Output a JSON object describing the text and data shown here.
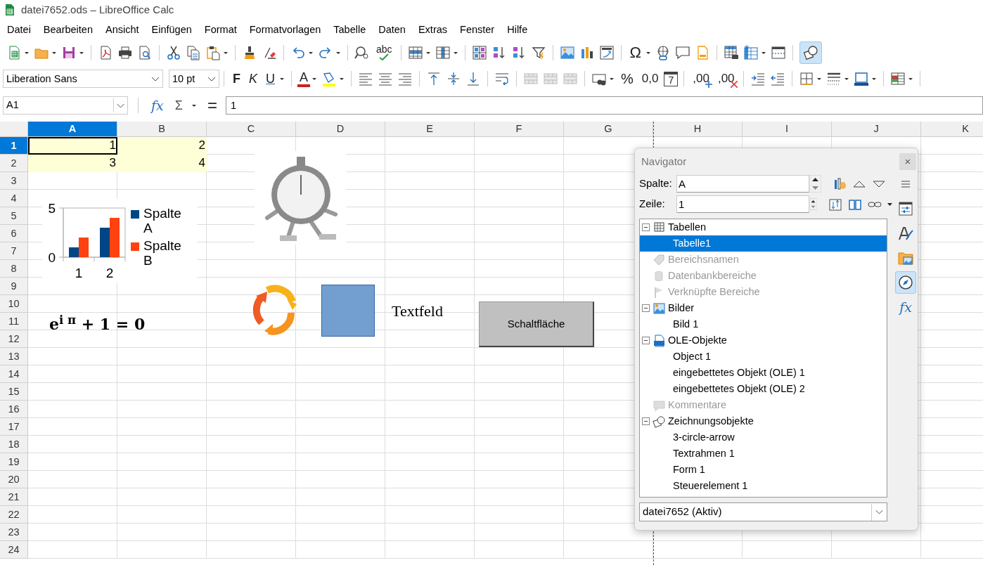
{
  "window": {
    "title": "datei7652.ods – LibreOffice Calc"
  },
  "menu": [
    {
      "label": "Datei"
    },
    {
      "label": "Bearbeiten"
    },
    {
      "label": "Ansicht"
    },
    {
      "label": "Einfügen"
    },
    {
      "label": "Format"
    },
    {
      "label": "Formatvorlagen"
    },
    {
      "label": "Tabelle"
    },
    {
      "label": "Daten"
    },
    {
      "label": "Extras"
    },
    {
      "label": "Fenster"
    },
    {
      "label": "Hilfe"
    }
  ],
  "standard_toolbar": {
    "spelling": "abc",
    "special_character": "Ω",
    "draw_functions_active": true
  },
  "formatting_toolbar": {
    "font_name": "Liberation Sans",
    "font_size": "10 pt",
    "bold": "F",
    "italic": "K",
    "underline": "U",
    "font_color": "A",
    "percent": "%",
    "number": "0,0",
    "date": "7",
    "add_decimal": ",00",
    "delete_decimal": ",00"
  },
  "formula_bar": {
    "name_box": "A1",
    "function_wizard": "fx",
    "sum": "Σ",
    "formula": "=",
    "content": "1"
  },
  "sheet": {
    "columns": [
      {
        "label": "A",
        "selected": true
      },
      {
        "label": "B",
        "selected": false
      },
      {
        "label": "C",
        "selected": false
      },
      {
        "label": "D",
        "selected": false
      },
      {
        "label": "E",
        "selected": false
      },
      {
        "label": "F",
        "selected": false
      },
      {
        "label": "G",
        "selected": false
      },
      {
        "label": "H",
        "selected": false
      },
      {
        "label": "I",
        "selected": false
      },
      {
        "label": "J",
        "selected": false
      },
      {
        "label": "K",
        "selected": false
      }
    ],
    "rows": [
      {
        "label": "1",
        "selected": true,
        "cells": [
          {
            "value": "1",
            "active": true
          },
          {
            "value": "2",
            "active": false
          }
        ]
      },
      {
        "label": "2",
        "selected": false,
        "cells": [
          {
            "value": "3",
            "active": false
          },
          {
            "value": "4",
            "active": false
          }
        ]
      },
      {
        "label": "3",
        "selected": false
      },
      {
        "label": "4",
        "selected": false
      },
      {
        "label": "5",
        "selected": false
      },
      {
        "label": "6",
        "selected": false
      },
      {
        "label": "7",
        "selected": false
      },
      {
        "label": "8",
        "selected": false
      },
      {
        "label": "9",
        "selected": false
      },
      {
        "label": "10",
        "selected": false
      },
      {
        "label": "11",
        "selected": false
      },
      {
        "label": "12",
        "selected": false
      },
      {
        "label": "13",
        "selected": false
      },
      {
        "label": "14",
        "selected": false
      },
      {
        "label": "15",
        "selected": false
      },
      {
        "label": "16",
        "selected": false
      },
      {
        "label": "17",
        "selected": false
      },
      {
        "label": "18",
        "selected": false
      },
      {
        "label": "19",
        "selected": false
      },
      {
        "label": "20",
        "selected": false
      },
      {
        "label": "21",
        "selected": false
      },
      {
        "label": "22",
        "selected": false
      },
      {
        "label": "23",
        "selected": false
      },
      {
        "label": "24",
        "selected": false
      }
    ]
  },
  "objects": {
    "chart": {
      "chart_data": {
        "type": "bar",
        "categories": [
          "1",
          "2"
        ],
        "series": [
          {
            "name": "Spalte A",
            "color": "#004586",
            "values": [
              1,
              3
            ]
          },
          {
            "name": "Spalte B",
            "color": "#ff420e",
            "values": [
              2,
              4
            ]
          }
        ],
        "ylim": [
          0,
          5
        ],
        "yticks": [
          0,
          5
        ],
        "legend": "right"
      }
    },
    "formula": "e$^{i π}$ + 1 = 0",
    "text_box": "Textfeld",
    "button": "Schaltfläche"
  },
  "navigator": {
    "title": "Navigator",
    "close": "×",
    "column_label": "Spalte:",
    "column_value": "A",
    "row_label": "Zeile:",
    "row_value": "1",
    "tree": [
      {
        "label": "Tabellen",
        "kind": "sheets",
        "expanded": true,
        "disabled": false,
        "selected": false,
        "children": [
          {
            "label": "Tabelle1",
            "selected": true,
            "disabled": false
          }
        ]
      },
      {
        "label": "Bereichsnamen",
        "kind": "names",
        "disabled": true,
        "selected": false
      },
      {
        "label": "Datenbankbereiche",
        "kind": "database",
        "disabled": true,
        "selected": false
      },
      {
        "label": "Verknüpfte Bereiche",
        "kind": "links",
        "disabled": true,
        "selected": false
      },
      {
        "label": "Bilder",
        "kind": "images",
        "expanded": true,
        "disabled": false,
        "selected": false,
        "children": [
          {
            "label": "Bild 1",
            "selected": false,
            "disabled": false
          }
        ]
      },
      {
        "label": "OLE-Objekte",
        "kind": "ole",
        "expanded": true,
        "disabled": false,
        "selected": false,
        "children": [
          {
            "label": "Object 1",
            "selected": false,
            "disabled": false
          },
          {
            "label": "eingebettetes Objekt (OLE) 1",
            "selected": false,
            "disabled": false
          },
          {
            "label": "eingebettetes Objekt (OLE) 2",
            "selected": false,
            "disabled": false
          }
        ]
      },
      {
        "label": "Kommentare",
        "kind": "comments",
        "disabled": true,
        "selected": false
      },
      {
        "label": "Zeichnungsobjekte",
        "kind": "drawings",
        "expanded": true,
        "disabled": false,
        "selected": false,
        "children": [
          {
            "label": "3-circle-arrow",
            "selected": false,
            "disabled": false
          },
          {
            "label": "Textrahmen 1",
            "selected": false,
            "disabled": false
          },
          {
            "label": "Form 1",
            "selected": false,
            "disabled": false
          },
          {
            "label": "Steuerelement 1",
            "selected": false,
            "disabled": false
          }
        ]
      }
    ],
    "document": "datei7652 (Aktiv)",
    "sidebar_tabs": [
      {
        "kind": "properties",
        "selected": false
      },
      {
        "kind": "styles",
        "selected": false
      },
      {
        "kind": "gallery",
        "selected": false
      },
      {
        "kind": "navigator",
        "selected": true
      },
      {
        "kind": "functions",
        "selected": false,
        "glyph": "fx"
      }
    ]
  }
}
